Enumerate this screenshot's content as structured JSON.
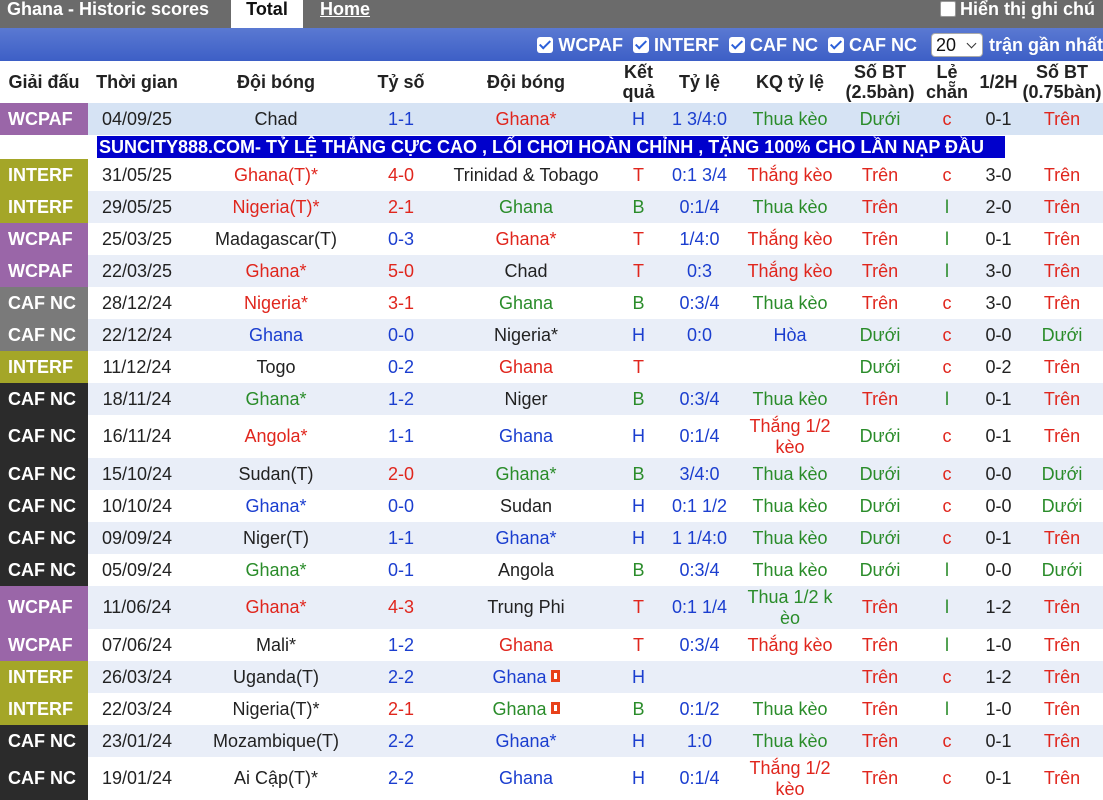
{
  "header": {
    "title": "Ghana - Historic scores",
    "tab_total": "Total",
    "tab_home": "Home",
    "note_label": "Hiển thị ghi chú"
  },
  "filters": {
    "items": [
      "WCPAF",
      "INTERF",
      "CAF NC",
      "CAF NC"
    ],
    "count_value": "20",
    "count_label": "trận gần nhất"
  },
  "columns": [
    "Giải đấu",
    "Thời gian",
    "Đội bóng",
    "Tỷ số",
    "Đội bóng",
    "Kết quả",
    "Tỷ lệ",
    "KQ tỷ lệ",
    "Số BT (2.5bàn)",
    "Lẻ chẵn",
    "1/2H",
    "Số BT (0.75bàn)"
  ],
  "colors": {
    "WCPAF": "#9a66a8",
    "INTERF": "#a4a628",
    "CAF NC": "#2b2b2b",
    "CAF NC gray": "#7a7a7a"
  },
  "banner": "SUNCITY888.COM- TỶ LỆ THẮNG CỰC CAO , LỐI CHƠI HOÀN CHỈNH , TẶNG 100% CHO LẦN NẠP ĐẦU",
  "matches": [
    {
      "comp": "WCPAF",
      "date": "04/09/25",
      "home": "Chad",
      "away": "Ghana*",
      "score": "1-1",
      "res": "H",
      "odds": "1 3/4:0",
      "oddsres": "Thua kèo",
      "ou": "Dưới",
      "oe": "c",
      "half": "0-1",
      "ou2": "Trên"
    },
    {
      "comp": "INTERF",
      "date": "31/05/25",
      "home": "Ghana(T)*",
      "away": "Trinidad & Tobago",
      "score": "4-0",
      "res": "T",
      "odds": "0:1 3/4",
      "oddsres": "Thắng kèo",
      "ou": "Trên",
      "oe": "c",
      "half": "3-0",
      "ou2": "Trên"
    },
    {
      "comp": "INTERF",
      "date": "29/05/25",
      "home": "Nigeria(T)*",
      "away": "Ghana",
      "score": "2-1",
      "res": "B",
      "odds": "0:1/4",
      "oddsres": "Thua kèo",
      "ou": "Trên",
      "oe": "l",
      "half": "2-0",
      "ou2": "Trên"
    },
    {
      "comp": "WCPAF",
      "date": "25/03/25",
      "home": "Madagascar(T)",
      "away": "Ghana*",
      "score": "0-3",
      "res": "T",
      "odds": "1/4:0",
      "oddsres": "Thắng kèo",
      "ou": "Trên",
      "oe": "l",
      "half": "0-1",
      "ou2": "Trên"
    },
    {
      "comp": "WCPAF",
      "date": "22/03/25",
      "home": "Ghana*",
      "away": "Chad",
      "score": "5-0",
      "res": "T",
      "odds": "0:3",
      "oddsres": "Thắng kèo",
      "ou": "Trên",
      "oe": "l",
      "half": "3-0",
      "ou2": "Trên"
    },
    {
      "comp": "CAF NC",
      "date": "28/12/24",
      "home": "Nigeria*",
      "away": "Ghana",
      "score": "3-1",
      "res": "B",
      "odds": "0:3/4",
      "oddsres": "Thua kèo",
      "ou": "Trên",
      "oe": "c",
      "half": "3-0",
      "ou2": "Trên"
    },
    {
      "comp": "CAF NC",
      "date": "22/12/24",
      "home": "Ghana",
      "away": "Nigeria*",
      "score": "0-0",
      "res": "H",
      "odds": "0:0",
      "oddsres": "Hòa",
      "ou": "Dưới",
      "oe": "c",
      "half": "0-0",
      "ou2": "Dưới"
    },
    {
      "comp": "INTERF",
      "date": "11/12/24",
      "home": "Togo",
      "away": "Ghana",
      "score": "0-2",
      "res": "T",
      "odds": "",
      "oddsres": "",
      "ou": "Dưới",
      "oe": "c",
      "half": "0-2",
      "ou2": "Trên"
    },
    {
      "comp": "CAF NC",
      "date": "18/11/24",
      "home": "Ghana*",
      "away": "Niger",
      "score": "1-2",
      "res": "B",
      "odds": "0:3/4",
      "oddsres": "Thua kèo",
      "ou": "Trên",
      "oe": "l",
      "half": "0-1",
      "ou2": "Trên"
    },
    {
      "comp": "CAF NC",
      "date": "16/11/24",
      "home": "Angola*",
      "away": "Ghana",
      "score": "1-1",
      "res": "H",
      "odds": "0:1/4",
      "oddsres": "Thắng 1/2 kèo",
      "ou": "Dưới",
      "oe": "c",
      "half": "0-1",
      "ou2": "Trên"
    },
    {
      "comp": "CAF NC",
      "date": "15/10/24",
      "home": "Sudan(T)",
      "away": "Ghana*",
      "score": "2-0",
      "res": "B",
      "odds": "3/4:0",
      "oddsres": "Thua kèo",
      "ou": "Dưới",
      "oe": "c",
      "half": "0-0",
      "ou2": "Dưới"
    },
    {
      "comp": "CAF NC",
      "date": "10/10/24",
      "home": "Ghana*",
      "away": "Sudan",
      "score": "0-0",
      "res": "H",
      "odds": "0:1 1/2",
      "oddsres": "Thua kèo",
      "ou": "Dưới",
      "oe": "c",
      "half": "0-0",
      "ou2": "Dưới"
    },
    {
      "comp": "CAF NC",
      "date": "09/09/24",
      "home": "Niger(T)",
      "away": "Ghana*",
      "score": "1-1",
      "res": "H",
      "odds": "1 1/4:0",
      "oddsres": "Thua kèo",
      "ou": "Dưới",
      "oe": "c",
      "half": "0-1",
      "ou2": "Trên"
    },
    {
      "comp": "CAF NC",
      "date": "05/09/24",
      "home": "Ghana*",
      "away": "Angola",
      "score": "0-1",
      "res": "B",
      "odds": "0:3/4",
      "oddsres": "Thua kèo",
      "ou": "Dưới",
      "oe": "l",
      "half": "0-0",
      "ou2": "Dưới"
    },
    {
      "comp": "WCPAF",
      "date": "11/06/24",
      "home": "Ghana*",
      "away": "Trung Phi",
      "score": "4-3",
      "res": "T",
      "odds": "0:1 1/4",
      "oddsres": "Thua 1/2 k èo",
      "ou": "Trên",
      "oe": "l",
      "half": "1-2",
      "ou2": "Trên"
    },
    {
      "comp": "WCPAF",
      "date": "07/06/24",
      "home": "Mali*",
      "away": "Ghana",
      "score": "1-2",
      "res": "T",
      "odds": "0:3/4",
      "oddsres": "Thắng kèo",
      "ou": "Trên",
      "oe": "l",
      "half": "1-0",
      "ou2": "Trên"
    },
    {
      "comp": "INTERF",
      "date": "26/03/24",
      "home": "Uganda(T)",
      "away": "Ghana",
      "score": "2-2",
      "res": "H",
      "odds": "",
      "oddsres": "",
      "ou": "Trên",
      "oe": "c",
      "half": "1-2",
      "ou2": "Trên"
    },
    {
      "comp": "INTERF",
      "date": "22/03/24",
      "home": "Nigeria(T)*",
      "away": "Ghana",
      "score": "2-1",
      "res": "B",
      "odds": "0:1/2",
      "oddsres": "Thua kèo",
      "ou": "Trên",
      "oe": "l",
      "half": "1-0",
      "ou2": "Trên"
    },
    {
      "comp": "CAF NC",
      "date": "23/01/24",
      "home": "Mozambique(T)",
      "away": "Ghana*",
      "score": "2-2",
      "res": "H",
      "odds": "1:0",
      "oddsres": "Thua kèo",
      "ou": "Trên",
      "oe": "c",
      "half": "0-1",
      "ou2": "Trên"
    },
    {
      "comp": "CAF NC",
      "date": "19/01/24",
      "home": "Ai Cập(T)*",
      "away": "Ghana",
      "score": "2-2",
      "res": "H",
      "odds": "0:1/4",
      "oddsres": "Thắng 1/2 kèo",
      "ou": "Trên",
      "oe": "c",
      "half": "0-1",
      "ou2": "Trên"
    }
  ]
}
